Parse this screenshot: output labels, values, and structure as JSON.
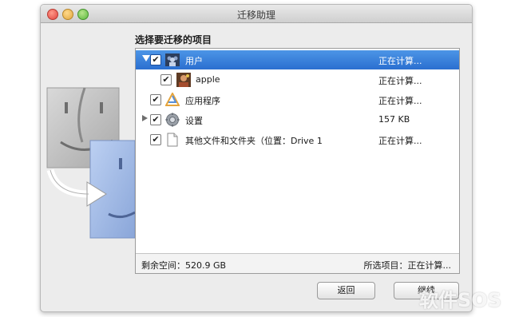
{
  "window": {
    "title": "迁移助理"
  },
  "section": {
    "title": "选择要迁移的项目"
  },
  "rows": [
    {
      "label": "用户",
      "status": "正在计算...",
      "checked": true,
      "icon": "users-icon",
      "expanded": true,
      "selected": true
    },
    {
      "label": "apple",
      "status": "正在计算...",
      "checked": true,
      "icon": "user-avatar-icon"
    },
    {
      "label": "应用程序",
      "status": "正在计算...",
      "checked": true,
      "icon": "applications-icon"
    },
    {
      "label": "设置",
      "status": "157 KB",
      "checked": true,
      "icon": "gear-icon",
      "expanded": false
    },
    {
      "label": "其他文件和文件夹（位置：Drive 1",
      "status": "正在计算...",
      "checked": true,
      "icon": "document-icon"
    }
  ],
  "checkmark": "✔",
  "status_bar": {
    "free_space": "剩余空间：520.9 GB",
    "selected_items": "所选项目：正在计算..."
  },
  "buttons": {
    "back": "返回",
    "continue": "继续"
  },
  "watermark": "软件SOS",
  "colors": {
    "selection": "#3a83dc",
    "window_bg": "#ececec"
  }
}
